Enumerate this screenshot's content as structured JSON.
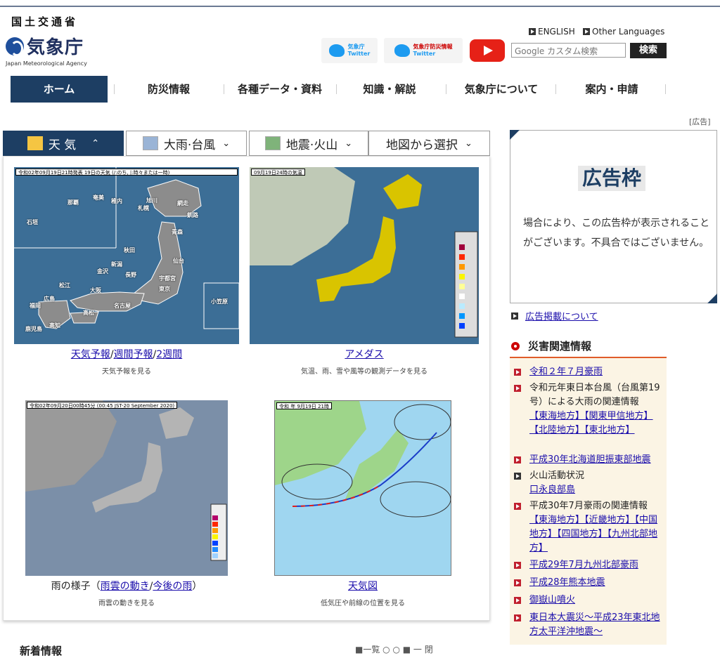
{
  "header": {
    "ministry": "国土交通省",
    "agency": "気象庁",
    "agency_en": "Japan Meteorological Agency",
    "twitter1_a": "気象庁",
    "twitter1_b": "Twitter",
    "twitter2_a": "気象庁防災情報",
    "twitter2_b": "Twitter",
    "english": "ENGLISH",
    "other_languages": "Other Languages",
    "search_placeholder": "Google カスタム検索",
    "search_button": "検索"
  },
  "nav": [
    "ホーム",
    "防災情報",
    "各種データ・資料",
    "知識・解説",
    "気象庁について",
    "案内・申請"
  ],
  "ad_tag": "[広告]",
  "tabs": [
    "天 気",
    "大雨·台風",
    "地震·火山",
    "地図から選択"
  ],
  "tab_chevrons": [
    "⌃",
    "⌄",
    "⌄",
    "⌄"
  ],
  "maps": {
    "weather_header": "令和02年09月19日21時発表  19日の天気  (/:のち, |:時々または一時)",
    "amedas_header": "09月19日24時の気温",
    "rain_header": "令和02年09月20日00時45分 (00:45 JST-20 September 2020)",
    "chart_header": "令和 年 9月19日 21時",
    "cities": [
      "稚内",
      "旭川",
      "札幌",
      "釧路",
      "網走",
      "青森",
      "秋田",
      "仙台",
      "新潟",
      "金沢",
      "長野",
      "宇都宮",
      "東京",
      "名古屋",
      "大阪",
      "松江",
      "広島",
      "高松",
      "福岡",
      "高知",
      "鹿児島",
      "那覇",
      "奄美",
      "石垣",
      "小笠原"
    ]
  },
  "cards": {
    "forecast_link1": "天気予報",
    "forecast_sep": "/",
    "forecast_link2": "週間予報",
    "forecast_link3": "2週間",
    "forecast_sub": "天気予報を見る",
    "amedas_link": "アメダス",
    "amedas_sub": "気温、雨、雪や風等の観測データを見る",
    "rain_prefix": "雨の様子（",
    "rain_link1": "雨雲の動き",
    "rain_link2": "今後の雨",
    "rain_suffix": "）",
    "rain_sub": "雨雲の動きを見る",
    "chart_link": "天気図",
    "chart_sub": "低気圧や前線の位置を見る"
  },
  "ad": {
    "big": "広告枠",
    "text": "場合により、この広告枠が表示されることがございます。不具合ではございません。",
    "link": "広告掲載について"
  },
  "disaster": {
    "title": "災害関連情報",
    "items": [
      {
        "text": "令和２年７月豪雨",
        "link": true
      },
      {
        "text": "令和元年東日本台風（台風第19号）による大雨の関連情報",
        "link": false,
        "sublinks": [
          "【東海地方】",
          "【関東甲信地方】",
          "【北陸地方】",
          "【東北地方】"
        ]
      },
      {
        "text": "平成30年北海道胆振東部地震",
        "link": true
      },
      {
        "text": "火山活動状況",
        "link": false,
        "sublinks": [
          "口永良部島"
        ]
      },
      {
        "text": "平成30年7月豪雨の関連情報",
        "link": false,
        "sublinks": [
          "【東海地方】",
          "【近畿地方】",
          "【中国地方】",
          "【四国地方】",
          "【九州北部地方】"
        ]
      },
      {
        "text": "平成29年7月九州北部豪雨",
        "link": true
      },
      {
        "text": "平成28年熊本地震",
        "link": true
      },
      {
        "text": "御嶽山噴火",
        "link": true
      },
      {
        "text": "東日本大震災～平成23年東北地方太平洋沖地震～",
        "link": true
      }
    ]
  },
  "bottom": {
    "new_info": "新着情報",
    "right": "■一覧 ○ ○ ■ 一 閉"
  },
  "colors": {
    "navy": "#1d3e63",
    "red": "#c0202e",
    "sea": "#3c6e96",
    "land": "#8c8c8c"
  }
}
